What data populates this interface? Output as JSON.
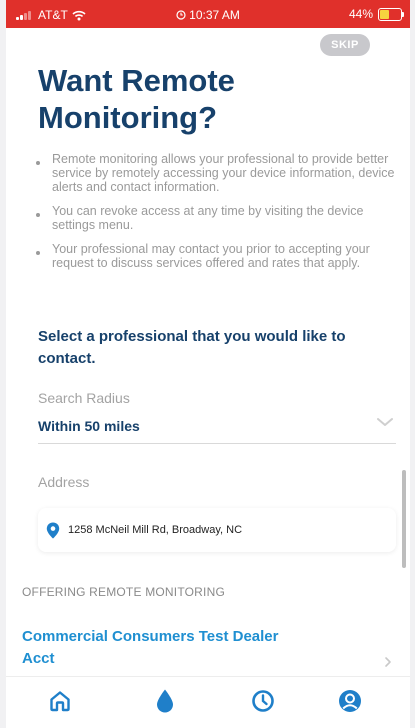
{
  "status_bar": {
    "carrier": "AT&T",
    "time": "10:37 AM",
    "battery": "44%",
    "battery_level": 0.44
  },
  "skip_label": "SKIP",
  "title": "Want Remote Monitoring?",
  "bullets": [
    "Remote monitoring allows your professional to provide better service by remotely accessing your device information, device alerts and contact information.",
    "You can revoke access at any time by visiting the device settings menu.",
    "Your professional may contact you prior to accepting your request to discuss services offered and rates that apply."
  ],
  "select_heading": "Select a professional that you would like to contact.",
  "search_radius": {
    "label": "Search Radius",
    "value": "Within 50 miles"
  },
  "address": {
    "label": "Address",
    "value": "1258 McNeil Mill Rd, Broadway, NC"
  },
  "section_label": "OFFERING REMOTE MONITORING",
  "dealers": [
    {
      "name": "Commercial Consumers Test Dealer Acct"
    }
  ],
  "colors": {
    "status_bar": "#e0302b",
    "brand_navy": "#17416b",
    "link_blue": "#1f8fd1",
    "tab_icon_blue": "#1f7fc9"
  },
  "tabs": [
    {
      "icon": "home-icon"
    },
    {
      "icon": "water-drop-icon"
    },
    {
      "icon": "clock-icon"
    },
    {
      "icon": "profile-icon"
    }
  ]
}
